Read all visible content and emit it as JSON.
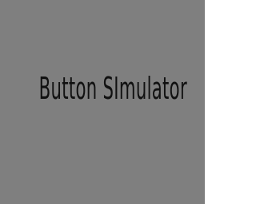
{
  "colors": {
    "background": "#7f7f7f",
    "title_text": "#111111"
  },
  "game": {
    "title": "Button SImulator"
  }
}
